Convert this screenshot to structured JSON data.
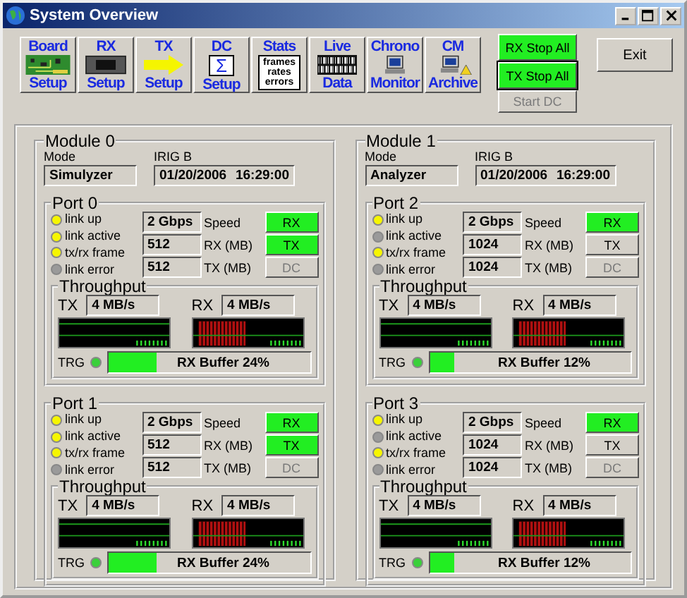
{
  "window": {
    "title": "System Overview"
  },
  "toolbar": [
    {
      "top": "Board",
      "bottom": "Setup"
    },
    {
      "top": "RX",
      "bottom": "Setup"
    },
    {
      "top": "TX",
      "bottom": "Setup"
    },
    {
      "top": "DC",
      "bottom": "Setup",
      "icon_text": "Σ"
    },
    {
      "top": "Stats",
      "icon_lines": [
        "frames",
        "rates",
        "errors"
      ]
    },
    {
      "top": "Live",
      "bottom": "Data"
    },
    {
      "top": "Chrono",
      "bottom": "Monitor"
    },
    {
      "top": "CM",
      "bottom": "Archive"
    }
  ],
  "actions": [
    {
      "label": "RX Stop All",
      "on": true,
      "focused": false,
      "disabled": false
    },
    {
      "label": "TX Stop All",
      "on": true,
      "focused": true,
      "disabled": false
    },
    {
      "label": "Start DC",
      "on": false,
      "focused": false,
      "disabled": true
    }
  ],
  "exit": "Exit",
  "modules": [
    {
      "title": "Module 0",
      "mode_label": "Mode",
      "mode": "Simulyzer",
      "irig_label": "IRIG B",
      "irig_date": "01/20/2006",
      "irig_time": "16:29:00",
      "ports": [
        {
          "title": "Port 0",
          "leds": [
            {
              "label": "link up",
              "on": true
            },
            {
              "label": "link active",
              "on": true
            },
            {
              "label": "tx/rx frame",
              "on": true
            },
            {
              "label": "link error",
              "on": false
            }
          ],
          "speed": "2 Gbps",
          "speed_label": "Speed",
          "rx_mb": "512",
          "rx_label": "RX (MB)",
          "tx_mb": "512",
          "tx_label": "TX (MB)",
          "buttons": [
            {
              "label": "RX",
              "on": true,
              "disabled": false
            },
            {
              "label": "TX",
              "on": true,
              "disabled": false
            },
            {
              "label": "DC",
              "on": false,
              "disabled": true
            }
          ],
          "throughput": {
            "title": "Throughput",
            "tx_label": "TX",
            "tx": "4 MB/s",
            "rx_label": "RX",
            "rx": "4 MB/s",
            "trg_label": "TRG",
            "trg_on": true,
            "buffer_text": "RX Buffer 24%",
            "level": 0.24
          }
        },
        {
          "title": "Port 1",
          "leds": [
            {
              "label": "link up",
              "on": true
            },
            {
              "label": "link active",
              "on": true
            },
            {
              "label": "tx/rx frame",
              "on": true
            },
            {
              "label": "link error",
              "on": false
            }
          ],
          "speed": "2 Gbps",
          "speed_label": "Speed",
          "rx_mb": "512",
          "rx_label": "RX (MB)",
          "tx_mb": "512",
          "tx_label": "TX (MB)",
          "buttons": [
            {
              "label": "RX",
              "on": true,
              "disabled": false
            },
            {
              "label": "TX",
              "on": true,
              "disabled": false
            },
            {
              "label": "DC",
              "on": false,
              "disabled": true
            }
          ],
          "throughput": {
            "title": "Throughput",
            "tx_label": "TX",
            "tx": "4 MB/s",
            "rx_label": "RX",
            "rx": "4 MB/s",
            "trg_label": "TRG",
            "trg_on": true,
            "buffer_text": "RX Buffer 24%",
            "level": 0.24
          }
        }
      ]
    },
    {
      "title": "Module 1",
      "mode_label": "Mode",
      "mode": "Analyzer",
      "irig_label": "IRIG B",
      "irig_date": "01/20/2006",
      "irig_time": "16:29:00",
      "ports": [
        {
          "title": "Port 2",
          "leds": [
            {
              "label": "link up",
              "on": true
            },
            {
              "label": "link active",
              "on": false
            },
            {
              "label": "tx/rx frame",
              "on": true
            },
            {
              "label": "link error",
              "on": false
            }
          ],
          "speed": "2 Gbps",
          "speed_label": "Speed",
          "rx_mb": "1024",
          "rx_label": "RX (MB)",
          "tx_mb": "1024",
          "tx_label": "TX (MB)",
          "buttons": [
            {
              "label": "RX",
              "on": true,
              "disabled": false
            },
            {
              "label": "TX",
              "on": false,
              "disabled": false
            },
            {
              "label": "DC",
              "on": false,
              "disabled": true
            }
          ],
          "throughput": {
            "title": "Throughput",
            "tx_label": "TX",
            "tx": "4 MB/s",
            "rx_label": "RX",
            "rx": "4 MB/s",
            "trg_label": "TRG",
            "trg_on": true,
            "buffer_text": "RX Buffer 12%",
            "level": 0.12
          }
        },
        {
          "title": "Port 3",
          "leds": [
            {
              "label": "link up",
              "on": true
            },
            {
              "label": "link active",
              "on": false
            },
            {
              "label": "tx/rx frame",
              "on": true
            },
            {
              "label": "link error",
              "on": false
            }
          ],
          "speed": "2 Gbps",
          "speed_label": "Speed",
          "rx_mb": "1024",
          "rx_label": "RX (MB)",
          "tx_mb": "1024",
          "tx_label": "TX (MB)",
          "buttons": [
            {
              "label": "RX",
              "on": true,
              "disabled": false
            },
            {
              "label": "TX",
              "on": false,
              "disabled": false
            },
            {
              "label": "DC",
              "on": false,
              "disabled": true
            }
          ],
          "throughput": {
            "title": "Throughput",
            "tx_label": "TX",
            "tx": "4 MB/s",
            "rx_label": "RX",
            "rx": "4 MB/s",
            "trg_label": "TRG",
            "trg_on": true,
            "buffer_text": "RX Buffer 12%",
            "level": 0.12
          }
        }
      ]
    }
  ]
}
